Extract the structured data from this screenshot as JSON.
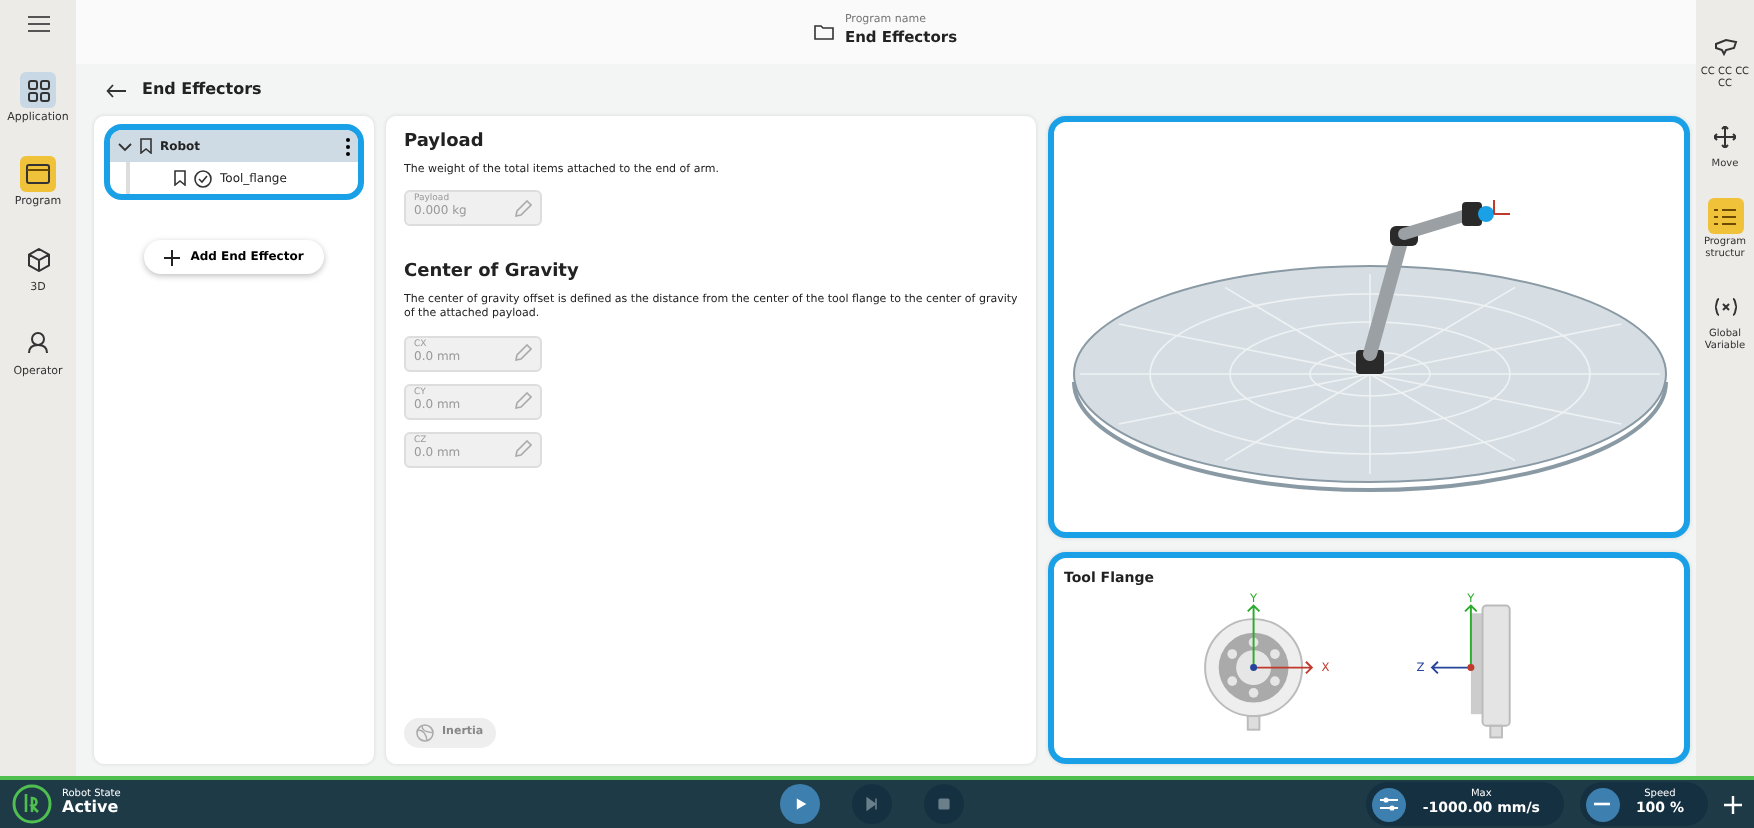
{
  "left_nav": {
    "items": [
      {
        "label": "Application",
        "kind": "grid",
        "selected": true
      },
      {
        "label": "Program",
        "kind": "program",
        "selected": false
      },
      {
        "label": "3D",
        "kind": "cube",
        "selected": false
      },
      {
        "label": "Operator",
        "kind": "person",
        "selected": false
      }
    ]
  },
  "header": {
    "caption": "Program name",
    "title": "End Effectors"
  },
  "page_title": "End Effectors",
  "tree": {
    "highlighted": true,
    "root": {
      "label": "Robot",
      "expanded": true,
      "children": [
        {
          "label": "Tool_flange"
        }
      ]
    }
  },
  "add_button": "Add End Effector",
  "payload": {
    "title": "Payload",
    "description": "The weight of the total items attached to the end of arm.",
    "fields": [
      {
        "label": "Payload",
        "value": "0.000 kg",
        "disabled": true
      }
    ]
  },
  "center_of_gravity": {
    "title": "Center of Gravity",
    "description": "The center of gravity offset is defined as the distance from the center of the tool flange to the center of gravity of the attached payload.",
    "fields": [
      {
        "label": "CX",
        "value": "0.0 mm",
        "disabled": true
      },
      {
        "label": "CY",
        "value": "0.0 mm",
        "disabled": true
      },
      {
        "label": "CZ",
        "value": "0.0 mm",
        "disabled": true
      }
    ]
  },
  "inertia_button": {
    "label": "Inertia",
    "disabled": true
  },
  "viewer": {
    "highlighted": true
  },
  "tool_flange": {
    "title": "Tool Flange",
    "highlighted": true,
    "axes": [
      "Y",
      "X",
      "Y",
      "Z"
    ]
  },
  "right_nav": {
    "items": [
      {
        "label": "CC CC CC CC",
        "kind": "hand",
        "selected": false
      },
      {
        "label": "Move",
        "kind": "move",
        "selected": false
      },
      {
        "label": "Program structur",
        "kind": "list",
        "selected": true
      },
      {
        "label": "Global Variable",
        "kind": "var",
        "selected": false
      }
    ]
  },
  "status_bar": {
    "state_caption": "Robot State",
    "state": "Active",
    "play": {
      "disabled": false
    },
    "step": {
      "disabled": true
    },
    "stop": {
      "disabled": true
    },
    "max_caption": "Max",
    "max_value": "-1000.00 mm/s",
    "speed_caption": "Speed",
    "speed_value": "100 %"
  }
}
